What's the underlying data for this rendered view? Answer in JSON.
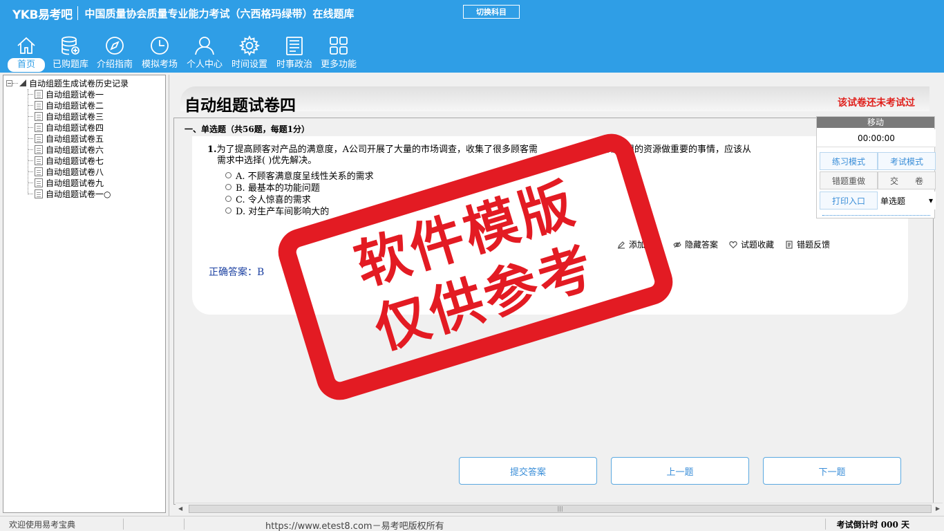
{
  "header": {
    "logo": "YKB易考吧",
    "title": "中国质量协会质量专业能力考试（六西格玛绿带）在线题库",
    "switch_subject": "切换科目"
  },
  "nav": [
    {
      "label": "首页",
      "icon": "home-icon"
    },
    {
      "label": "已购题库",
      "icon": "database-icon"
    },
    {
      "label": "介绍指南",
      "icon": "compass-icon"
    },
    {
      "label": "模拟考场",
      "icon": "clock-icon"
    },
    {
      "label": "个人中心",
      "icon": "user-icon"
    },
    {
      "label": "时间设置",
      "icon": "gear-icon"
    },
    {
      "label": "时事政治",
      "icon": "news-icon"
    },
    {
      "label": "更多功能",
      "icon": "grid-icon"
    }
  ],
  "tree": {
    "root": "自动组题生成试卷历史记录",
    "items": [
      "自动组题试卷一",
      "自动组题试卷二",
      "自动组题试卷三",
      "自动组题试卷四",
      "自动组题试卷五",
      "自动组题试卷六",
      "自动组题试卷七",
      "自动组题试卷八",
      "自动组题试卷九",
      "自动组题试卷一○"
    ]
  },
  "paper": {
    "title": "自动组题试卷四",
    "status": "该试卷还未考试过",
    "section": "一、单选题（共56题，每题1分）"
  },
  "question": {
    "number": "1.",
    "line1": "为了提高顾客对产品的满意度，A公司开展了大量的市场调查，收集了很多顾客需",
    "line1_tail": "能够利用有限的资源做重要的事情，应该从",
    "line2": "需求中选择( )优先解决。",
    "options": [
      "A. 不顾客满意度呈线性关系的需求",
      "B. 最基本的功能问题",
      "C. 令人惊喜的需求",
      "D. 对生产车间影响大的"
    ],
    "answer": "正确答案：B"
  },
  "tools": [
    "添加笔记",
    "隐藏答案",
    "试题收藏",
    "错题反馈"
  ],
  "buttons": {
    "submit": "提交答案",
    "prev": "上一题",
    "next": "下一题"
  },
  "timer": {
    "move": "移动",
    "clock": "00:00:00",
    "practice": "练习模式",
    "exam": "考试模式",
    "redo": "错题重做",
    "hand_in": "交　　卷",
    "print": "打印入口",
    "type_select": "单选题"
  },
  "watermark": {
    "line1": "软件模版",
    "line2": "仅供参考"
  },
  "status": {
    "welcome": "欢迎使用易考宝典",
    "copyright": "https://www.etest8.com－易考吧版权所有",
    "countdown": "考试倒计时 000 天"
  },
  "colors": {
    "header": "#2f9ee6",
    "accent": "#3a8ed8",
    "stamp": "#e31b23",
    "status_red": "#e0201c"
  }
}
